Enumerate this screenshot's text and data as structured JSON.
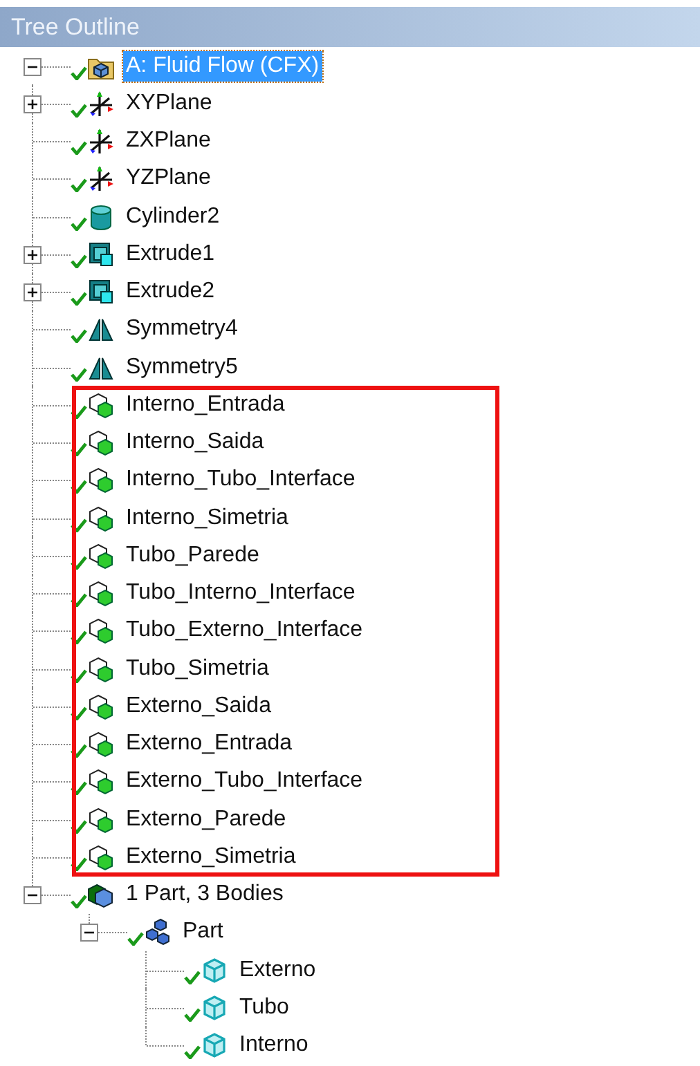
{
  "panel": {
    "title": "Tree Outline"
  },
  "tree": [
    {
      "label": "A: Fluid Flow (CFX)",
      "kind": "project",
      "expanded": true,
      "selected": true,
      "highlighted": false,
      "children": [
        {
          "label": "XYPlane",
          "kind": "plane",
          "expanded": false,
          "selected": false,
          "highlighted": false
        },
        {
          "label": "ZXPlane",
          "kind": "plane",
          "selected": false,
          "highlighted": false
        },
        {
          "label": "YZPlane",
          "kind": "plane",
          "selected": false,
          "highlighted": false
        },
        {
          "label": "Cylinder2",
          "kind": "cylinder",
          "selected": false,
          "highlighted": false
        },
        {
          "label": "Extrude1",
          "kind": "extrude",
          "expanded": false,
          "selected": false,
          "highlighted": false
        },
        {
          "label": "Extrude2",
          "kind": "extrude",
          "expanded": false,
          "selected": false,
          "highlighted": false
        },
        {
          "label": "Symmetry4",
          "kind": "symmetry",
          "selected": false,
          "highlighted": false
        },
        {
          "label": "Symmetry5",
          "kind": "symmetry",
          "selected": false,
          "highlighted": false
        },
        {
          "label": "Interno_Entrada",
          "kind": "selection",
          "selected": false,
          "highlighted": true
        },
        {
          "label": "Interno_Saida",
          "kind": "selection",
          "selected": false,
          "highlighted": true
        },
        {
          "label": "Interno_Tubo_Interface",
          "kind": "selection",
          "selected": false,
          "highlighted": true
        },
        {
          "label": "Interno_Simetria",
          "kind": "selection",
          "selected": false,
          "highlighted": true
        },
        {
          "label": "Tubo_Parede",
          "kind": "selection",
          "selected": false,
          "highlighted": true
        },
        {
          "label": "Tubo_Interno_Interface",
          "kind": "selection",
          "selected": false,
          "highlighted": true
        },
        {
          "label": "Tubo_Externo_Interface",
          "kind": "selection",
          "selected": false,
          "highlighted": true
        },
        {
          "label": "Tubo_Simetria",
          "kind": "selection",
          "selected": false,
          "highlighted": true
        },
        {
          "label": "Externo_Saida",
          "kind": "selection",
          "selected": false,
          "highlighted": true
        },
        {
          "label": "Externo_Entrada",
          "kind": "selection",
          "selected": false,
          "highlighted": true
        },
        {
          "label": "Externo_Tubo_Interface",
          "kind": "selection",
          "selected": false,
          "highlighted": true
        },
        {
          "label": "Externo_Parede",
          "kind": "selection",
          "selected": false,
          "highlighted": true
        },
        {
          "label": "Externo_Simetria",
          "kind": "selection",
          "selected": false,
          "highlighted": true
        },
        {
          "label": "1 Part, 3 Bodies",
          "kind": "parts",
          "expanded": true,
          "selected": false,
          "highlighted": false,
          "children": [
            {
              "label": "Part",
              "kind": "part",
              "expanded": true,
              "selected": false,
              "highlighted": false,
              "children": [
                {
                  "label": "Externo",
                  "kind": "body",
                  "selected": false,
                  "highlighted": false
                },
                {
                  "label": "Tubo",
                  "kind": "body",
                  "selected": false,
                  "highlighted": false
                },
                {
                  "label": "Interno",
                  "kind": "body",
                  "selected": false,
                  "highlighted": false
                }
              ]
            }
          ]
        }
      ]
    }
  ]
}
